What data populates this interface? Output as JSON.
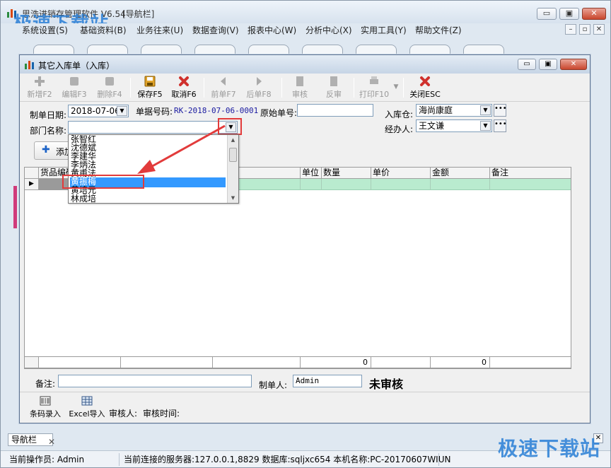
{
  "app": {
    "title_partial": "思浩进销存管理软件 V6.54",
    "title_tag": "[导航栏]",
    "watermark": "极速下载站",
    "window_controls": [
      "▭",
      "▣",
      "✕"
    ]
  },
  "menu": {
    "items": [
      "系统设置(S)",
      "基础资料(B)",
      "业务往来(U)",
      "数据查询(V)",
      "报表中心(W)",
      "分析中心(X)",
      "实用工具(Y)",
      "帮助文件(Z)"
    ]
  },
  "dialog": {
    "title": "其它入库单（入库）",
    "controls": [
      "▭",
      "▣",
      "✕"
    ]
  },
  "toolbar": {
    "new": "新增F2",
    "edit": "编辑F3",
    "delete": "删除F4",
    "save": "保存F5",
    "cancel": "取消F6",
    "prev": "前单F7",
    "next": "后单F8",
    "audit": "审核",
    "unaudit": "反审",
    "print": "打印F10",
    "close": "关闭ESC"
  },
  "form": {
    "date_label": "制单日期:",
    "date_value": "2018-07-06",
    "doc_no_label": "单据号码:",
    "doc_no_value": "RK-2018-07-06-0001",
    "orig_no_label": "原始单号:",
    "orig_no_value": "",
    "warehouse_label": "入库仓:",
    "warehouse_value": "海尚康庭",
    "dept_label": "部门名称:",
    "dept_value": "",
    "handler_label": "经办人:",
    "handler_value": "王文谦"
  },
  "add_button": "添加",
  "dropdown": {
    "items": [
      "张智红",
      "沈德斌",
      "李建华",
      "李炳法",
      "黄甫法",
      "黄振梅",
      "黄培元",
      "林成培"
    ],
    "selected_index": 5
  },
  "grid": {
    "columns": [
      "货品编码",
      "",
      "规格",
      "单位",
      "数量",
      "单价",
      "金额",
      "备注"
    ],
    "footer_qty": "0",
    "footer_amount": "0"
  },
  "bottom": {
    "remark_label": "备注:",
    "remark_value": "",
    "maker_label": "制单人:",
    "maker_value": "Admin",
    "status": "未审核",
    "barcode_label": "条码录入",
    "excel_label": "Excel导入",
    "auditor_label": "审核人:",
    "audit_time_label": "审核时间:"
  },
  "navbar": {
    "tab": "导航栏"
  },
  "statusbar": {
    "operator": "当前操作员: Admin",
    "connection": "当前连接的服务器:127.0.0.1,8829 数据库:sqljxc654 本机名称:PC-20170607WIUN"
  }
}
